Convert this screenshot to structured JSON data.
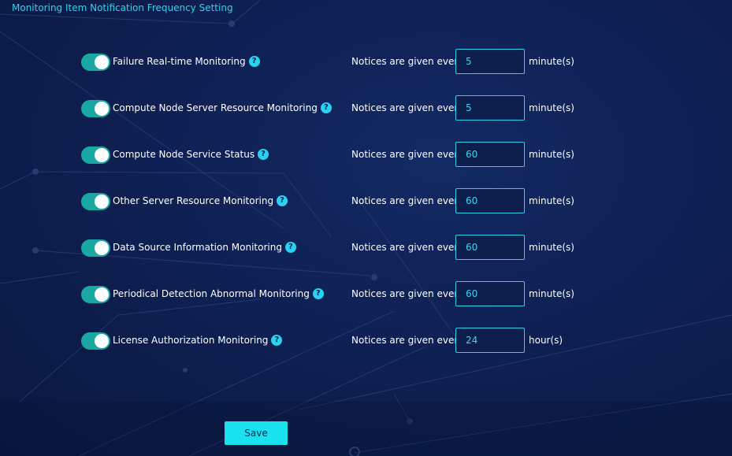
{
  "page": {
    "title": "Monitoring Item Notification Frequency Setting"
  },
  "rows": [
    {
      "label": "Failure Real-time Monitoring",
      "enabled": true,
      "notice_text": "Notices are given every",
      "value": "5",
      "unit": "minute(s)"
    },
    {
      "label": "Compute Node Server Resource Monitoring",
      "enabled": true,
      "notice_text": "Notices are given every",
      "value": "5",
      "unit": "minute(s)"
    },
    {
      "label": "Compute Node Service Status",
      "enabled": true,
      "notice_text": "Notices are given every",
      "value": "60",
      "unit": "minute(s)"
    },
    {
      "label": "Other Server Resource Monitoring",
      "enabled": true,
      "notice_text": "Notices are given every",
      "value": "60",
      "unit": "minute(s)"
    },
    {
      "label": "Data Source Information Monitoring",
      "enabled": true,
      "notice_text": "Notices are given every",
      "value": "60",
      "unit": "minute(s)"
    },
    {
      "label": "Periodical Detection Abnormal Monitoring",
      "enabled": true,
      "notice_text": "Notices are given every",
      "value": "60",
      "unit": "minute(s)"
    },
    {
      "label": "License Authorization Monitoring",
      "enabled": true,
      "notice_text": "Notices are given every",
      "value": "24",
      "unit": "hour(s)"
    }
  ],
  "help_icon": {
    "glyph": "?",
    "icon": "question-circle-icon"
  },
  "actions": {
    "save_label": "Save"
  },
  "colors": {
    "accent": "#27d6ee",
    "toggle_on": "#19a9a2",
    "button": "#19e2ee",
    "background": "#0f2155"
  }
}
